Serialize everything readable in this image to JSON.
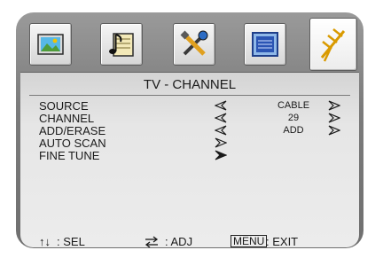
{
  "tabs": [
    {
      "icon": "picture-icon"
    },
    {
      "icon": "audio-icon"
    },
    {
      "icon": "setup-icon"
    },
    {
      "icon": "features-icon"
    },
    {
      "icon": "antenna-icon",
      "active": true
    }
  ],
  "title": "TV - CHANNEL",
  "menu": [
    {
      "label": "SOURCE",
      "value": "CABLE"
    },
    {
      "label": "CHANNEL",
      "value": "29"
    },
    {
      "label": "ADD/ERASE",
      "value": "ADD"
    },
    {
      "label": "AUTO SCAN"
    },
    {
      "label": "FINE TUNE",
      "selected": true
    }
  ],
  "footer": {
    "sel_arrows": "↑↓",
    "sel_label": ": SEL",
    "adj_label": ": ADJ",
    "menu_key": "MENU",
    "exit_label": ": EXIT"
  },
  "colors": {
    "frame": "#7c7c7c",
    "panel": "#e6e6e6",
    "text": "#1a1a1a"
  }
}
